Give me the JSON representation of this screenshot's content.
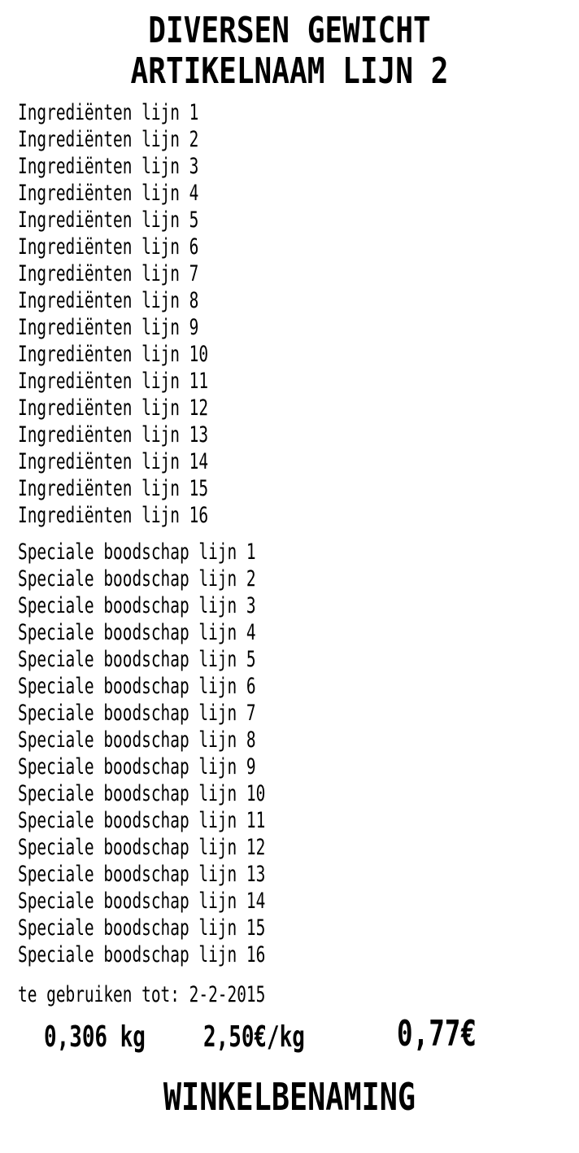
{
  "label": {
    "title_line_1": "DIVERSEN GEWICHT",
    "title_line_2": "ARTIKELNAAM LIJN 2",
    "ingredients": [
      "Ingrediënten lijn 1",
      "Ingrediënten lijn 2",
      "Ingrediënten lijn 3",
      "Ingrediënten lijn 4",
      "Ingrediënten lijn 5",
      "Ingrediënten lijn 6",
      "Ingrediënten lijn 7",
      "Ingrediënten lijn 8",
      "Ingrediënten lijn 9",
      "Ingrediënten lijn 10",
      "Ingrediënten lijn 11",
      "Ingrediënten lijn 12",
      "Ingrediënten lijn 13",
      "Ingrediënten lijn 14",
      "Ingrediënten lijn 15",
      "Ingrediënten lijn 16"
    ],
    "special_messages": [
      "Speciale boodschap lijn 1",
      "Speciale boodschap lijn 2",
      "Speciale boodschap lijn 3",
      "Speciale boodschap lijn 4",
      "Speciale boodschap lijn 5",
      "Speciale boodschap lijn 6",
      "Speciale boodschap lijn 7",
      "Speciale boodschap lijn 8",
      "Speciale boodschap lijn 9",
      "Speciale boodschap lijn 10",
      "Speciale boodschap lijn 11",
      "Speciale boodschap lijn 12",
      "Speciale boodschap lijn 13",
      "Speciale boodschap lijn 14",
      "Speciale boodschap lijn 15",
      "Speciale boodschap lijn 16"
    ],
    "use_by": "te gebruiken tot: 2-2-2015",
    "weight": "0,306 kg",
    "unit_price": "2,50€/kg",
    "total_price": "0,77€",
    "store_name": "WINKELBENAMING"
  }
}
